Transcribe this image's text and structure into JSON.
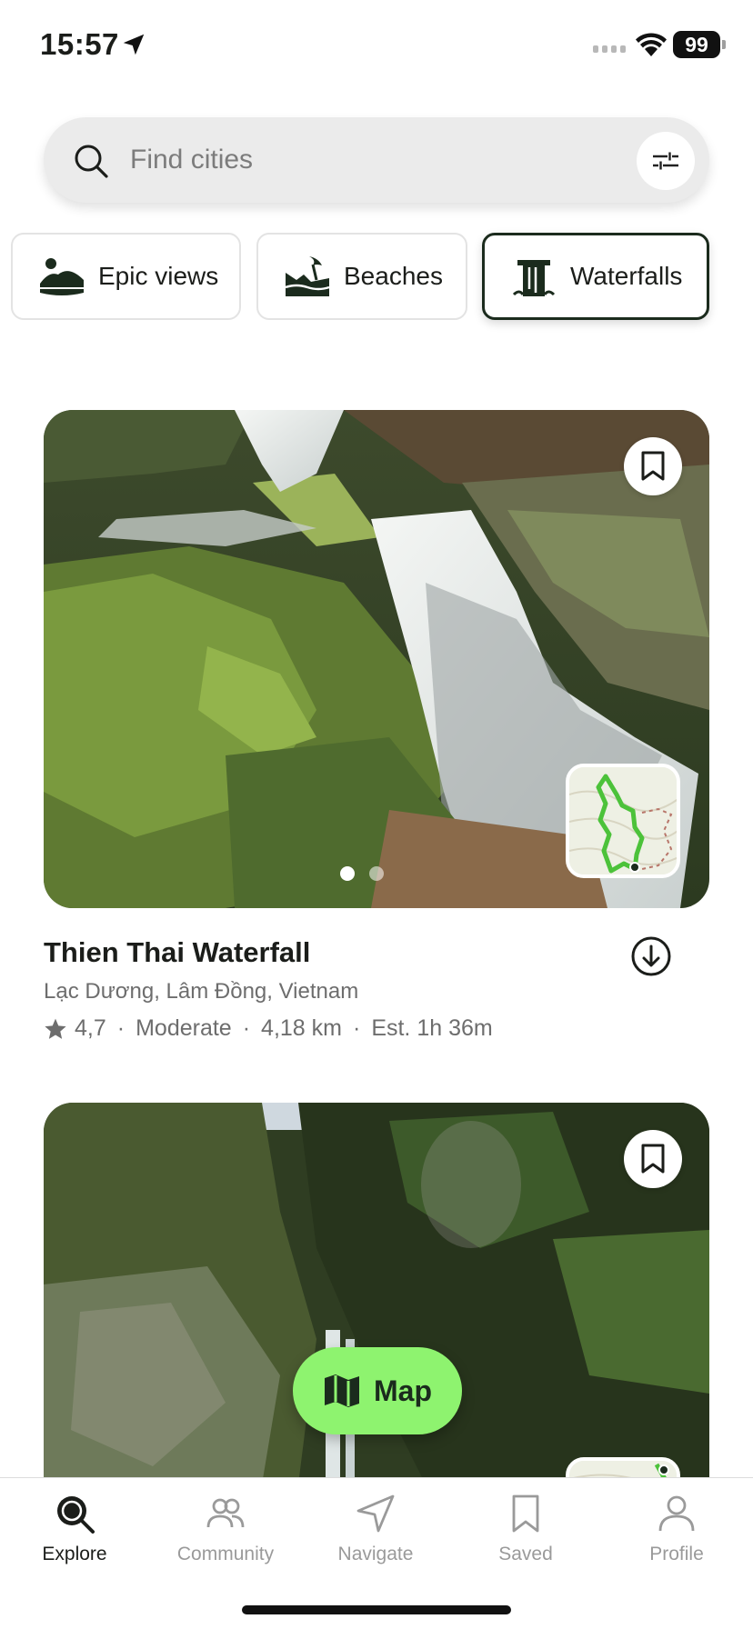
{
  "status_bar": {
    "time": "15:57",
    "battery": "99"
  },
  "search": {
    "placeholder": "Find cities",
    "value": ""
  },
  "categories": [
    {
      "label": "Epic views",
      "active": false
    },
    {
      "label": "Beaches",
      "active": false
    },
    {
      "label": "Waterfalls",
      "active": true
    }
  ],
  "trails": [
    {
      "title": "Thien Thai Waterfall",
      "location": "Lạc Dương, Lâm Đồng, Vietnam",
      "rating": "4,7",
      "difficulty": "Moderate",
      "distance": "4,18 km",
      "duration": "Est. 1h 36m",
      "photo_count": 2,
      "current_photo": 1
    }
  ],
  "map_button": {
    "label": "Map"
  },
  "tabs": [
    {
      "label": "Explore",
      "icon": "explore-icon",
      "active": true
    },
    {
      "label": "Community",
      "icon": "community-icon",
      "active": false
    },
    {
      "label": "Navigate",
      "icon": "navigate-icon",
      "active": false
    },
    {
      "label": "Saved",
      "icon": "saved-icon",
      "active": false
    },
    {
      "label": "Profile",
      "icon": "profile-icon",
      "active": false
    }
  ],
  "colors": {
    "accent": "#8ef36f",
    "dark_green": "#1b2b1d",
    "text_secondary": "#6d6d6d"
  }
}
